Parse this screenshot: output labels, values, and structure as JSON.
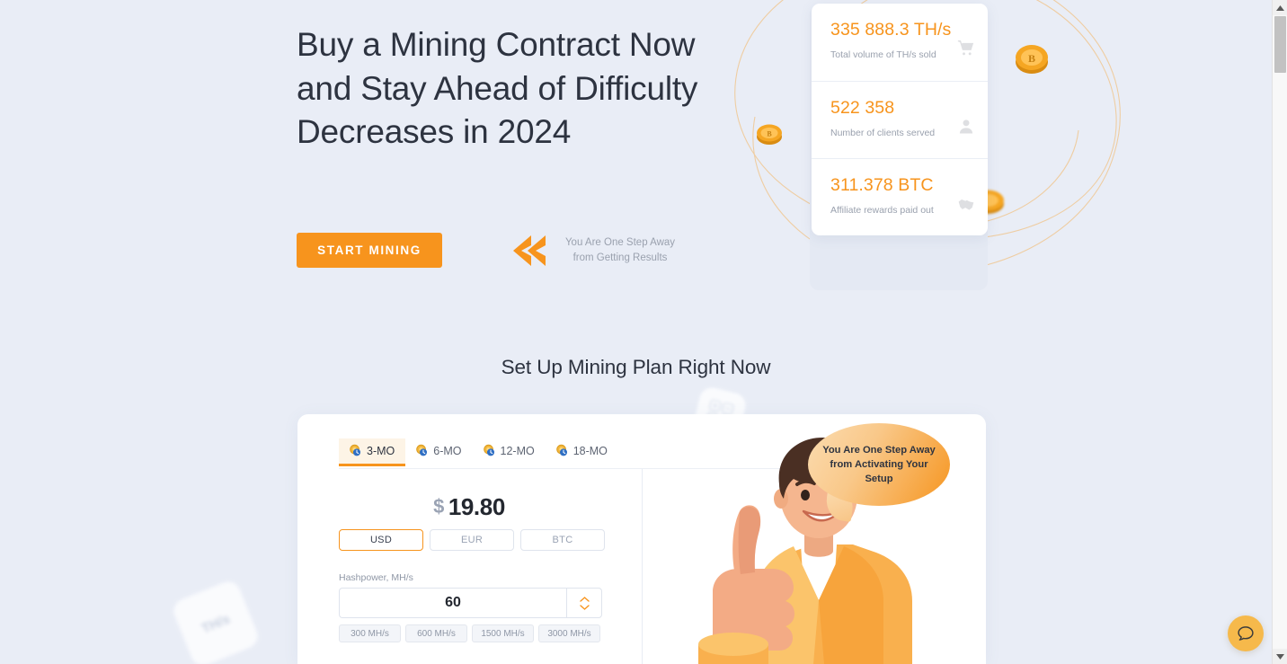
{
  "hero": {
    "title": "Buy a Mining Contract Now and Stay Ahead of Difficulty Decreases in 2024",
    "cta_label": "START MINING",
    "cta_note": "You Are One Step Away from Getting Results",
    "chevron_icon": "double-chevron-left-icon",
    "stats": [
      {
        "value": "335 888.3 TH/s",
        "label": "Total volume of TH/s sold",
        "icon": "shopping-cart-icon"
      },
      {
        "value": "522 358",
        "label": "Number of clients served",
        "icon": "person-icon"
      },
      {
        "value": "311.378 BTC",
        "label": "Affiliate rewards paid out",
        "icon": "handshake-icon"
      }
    ]
  },
  "section": {
    "title": "Set Up Mining Plan Right Now"
  },
  "plan": {
    "tabs": [
      {
        "label": "3-MO",
        "active": true
      },
      {
        "label": "6-MO",
        "active": false
      },
      {
        "label": "12-MO",
        "active": false
      },
      {
        "label": "18-MO",
        "active": false
      }
    ],
    "price": {
      "currency_symbol": "$",
      "amount": "19.80"
    },
    "currencies": [
      {
        "label": "USD",
        "active": true
      },
      {
        "label": "EUR",
        "active": false
      },
      {
        "label": "BTC",
        "active": false
      }
    ],
    "hashpower": {
      "label": "Hashpower, MH/s",
      "value": "60",
      "placeholder": "60",
      "stepper_up_icon": "chevron-up-icon",
      "stepper_down_icon": "chevron-down-icon"
    },
    "presets": [
      "300 MH/s",
      "600 MH/s",
      "1500 MH/s",
      "3000 MH/s"
    ],
    "bubble_text": "You Are One Step Away from Activating Your Setup",
    "illustration": "man-thumbs-up-illustration"
  },
  "decorations": {
    "tile_ths_text": "TH/s",
    "tile_calculator": "calculator-tile-icon"
  },
  "chat": {
    "icon": "chat-bubble-icon"
  },
  "scrollbar": {
    "up_icon": "scroll-up-arrow-icon",
    "down_icon": "scroll-down-arrow-icon"
  },
  "colors": {
    "accent": "#f7941d",
    "background": "#e9edf6",
    "text": "#2d3340",
    "muted": "#9aa1ae",
    "chat": "#f6b94b"
  }
}
